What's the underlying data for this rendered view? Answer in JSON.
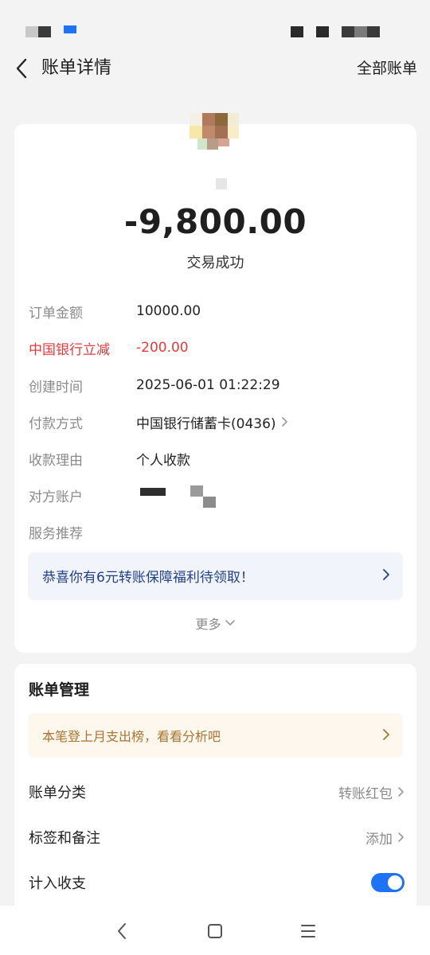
{
  "header": {
    "title": "账单详情",
    "all_bills": "全部账单"
  },
  "transaction": {
    "amount": "-9,800.00",
    "status": "交易成功",
    "details": [
      {
        "label": "订单金额",
        "value": "10000.00",
        "style": "normal"
      },
      {
        "label": "中国银行立减",
        "value": "-200.00",
        "style": "red"
      },
      {
        "label": "创建时间",
        "value": "2025-06-01 01:22:29",
        "style": "normal"
      },
      {
        "label": "付款方式",
        "value": "中国银行储蓄卡(0436)",
        "style": "normal"
      },
      {
        "label": "收款理由",
        "value": "个人收款",
        "style": "normal"
      },
      {
        "label": "对方账户",
        "value": "",
        "style": "normal"
      },
      {
        "label": "服务推荐",
        "value": "",
        "style": "normal"
      }
    ],
    "promo": "恭喜你有6元转账保障福利待领取！",
    "more": "更多"
  },
  "manage": {
    "title": "账单管理",
    "notice": "本笔登上月支出榜，看看分析吧",
    "rows": [
      {
        "label": "账单分类",
        "value": "转账红包"
      },
      {
        "label": "标签和备注",
        "value": "添加"
      },
      {
        "label": "计入收支",
        "value": ""
      }
    ],
    "toggle_on": true
  },
  "colors": {
    "accent": "#1e72f5",
    "red": "#e5393b",
    "promo_text": "#23418a",
    "notice_text": "#a9752f"
  },
  "icons": {
    "back": "chevron-left-icon",
    "nav_back": "nav-back-icon",
    "nav_home": "nav-home-icon",
    "nav_menu": "nav-menu-icon"
  }
}
